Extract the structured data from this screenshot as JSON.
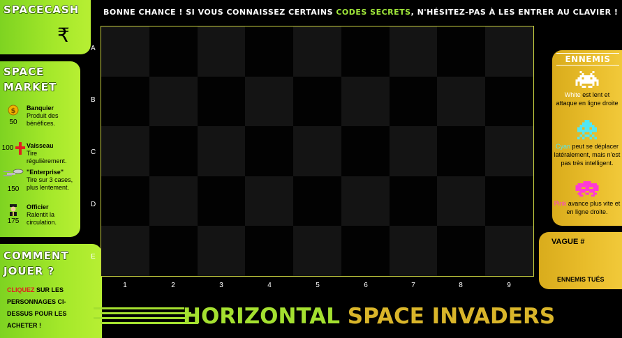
{
  "top_message": {
    "before": "Bonne chance ! Si vous connaissez certains ",
    "highlight": "codes secrets",
    "after": ", n'hésitez-pas à les entrer au clavier !"
  },
  "spacecash": {
    "heading": "SpaceCash",
    "currency_symbol": "₹",
    "value": ""
  },
  "market": {
    "heading": "Space Market",
    "items": [
      {
        "icon": "coin-icon",
        "price": "50",
        "name": "Banquier",
        "desc": "Produit des bénéfices."
      },
      {
        "icon": "ship-icon",
        "price": "100",
        "name": "Vaisseau",
        "desc": "Tire régulièrement."
      },
      {
        "icon": "enterprise-icon",
        "price": "150",
        "name": "\"Enterprise\"",
        "desc": "Tire sur 3 cases, plus lentement."
      },
      {
        "icon": "officer-icon",
        "price": "175",
        "name": "Officier",
        "desc": "Ralentit la circulation."
      }
    ]
  },
  "how_to": {
    "heading": "Comment jouer ?",
    "click_word": "Cliquez",
    "text": " sur les personnages ci-dessus pour les acheter !"
  },
  "enemies": {
    "heading": "Ennemis",
    "list": [
      {
        "icon": "white-invader-icon",
        "color": "#ffffff",
        "name": "White",
        "desc": " est lent et attaque en ligne droite"
      },
      {
        "icon": "cyan-invader-icon",
        "color": "#53e7f2",
        "name": "Cyan",
        "desc": " peut se déplacer latéralement, mais n'est pas très intelligent."
      },
      {
        "icon": "pink-invader-icon",
        "color": "#ff3ad7",
        "name": "Pink",
        "desc": " avance plus vite et en ligne droite."
      }
    ]
  },
  "wave": {
    "label": "Vague #",
    "kills_label": "Ennemis tués"
  },
  "board": {
    "rows": [
      "A",
      "B",
      "C",
      "D",
      "E"
    ],
    "cols": [
      "1",
      "2",
      "3",
      "4",
      "5",
      "6",
      "7",
      "8",
      "9"
    ]
  },
  "game_title": {
    "part1": "Horizontal",
    "part2": "Space Invaders"
  },
  "colors": {
    "green_panel": "#a4e82a",
    "gold_panel": "#e8bc2a",
    "board_border": "#c8d040"
  }
}
